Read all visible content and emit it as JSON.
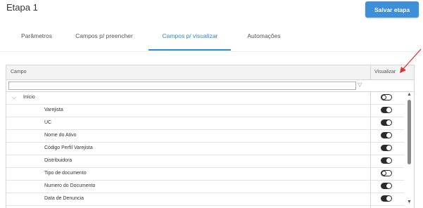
{
  "page": {
    "title": "Etapa 1"
  },
  "toolbar": {
    "save_label": "Salvar etapa"
  },
  "tabs": [
    {
      "label": "Parâmetros",
      "active": false
    },
    {
      "label": "Campos p/ preencher",
      "active": false
    },
    {
      "label": "Campos p/ visualizar",
      "active": true
    },
    {
      "label": "Automações",
      "active": false
    }
  ],
  "grid": {
    "columns": {
      "campo": "Campo",
      "visualizar": "Visualizar"
    },
    "filter": {
      "value": "",
      "icon": "filter-icon"
    },
    "group": {
      "label": "Início",
      "expanded": true,
      "visualizar": false
    },
    "rows": [
      {
        "label": "Varejista",
        "visualizar": true
      },
      {
        "label": "UC",
        "visualizar": true
      },
      {
        "label": "Nome do Ativo",
        "visualizar": true
      },
      {
        "label": "Código Perfil Varejista",
        "visualizar": true
      },
      {
        "label": "Distribuidora",
        "visualizar": true
      },
      {
        "label": "Tipo de documento",
        "visualizar": false
      },
      {
        "label": "Numero do Documento",
        "visualizar": true
      },
      {
        "label": "Data de Denuncia",
        "visualizar": true
      }
    ]
  },
  "colors": {
    "accent": "#2f86d6",
    "button": "#3d8fd8",
    "annotation_arrow": "#e03030"
  }
}
